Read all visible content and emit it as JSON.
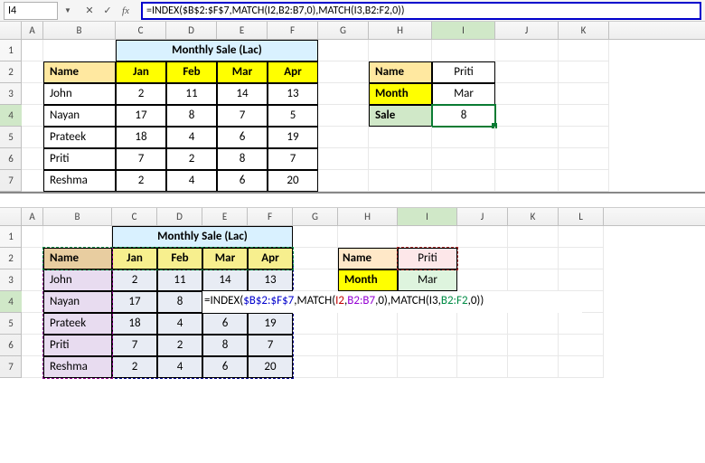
{
  "formula_bar": {
    "cell_ref": "I4",
    "fx_label": "fx",
    "formula": "=INDEX($B$2:$F$7,MATCH(I2,B2:B7,0),MATCH(I3,B2:F2,0))"
  },
  "columns": [
    "A",
    "B",
    "C",
    "D",
    "E",
    "F",
    "G",
    "H",
    "I",
    "J",
    "K",
    "L"
  ],
  "rows": [
    "1",
    "2",
    "3",
    "4",
    "5",
    "6",
    "7"
  ],
  "title": "Monthly Sale (Lac)",
  "headers": {
    "name": "Name",
    "months": [
      "Jan",
      "Feb",
      "Mar",
      "Apr"
    ]
  },
  "data": [
    {
      "name": "John",
      "vals": [
        "2",
        "11",
        "14",
        "13"
      ]
    },
    {
      "name": "Nayan",
      "vals": [
        "17",
        "8",
        "7",
        "5"
      ]
    },
    {
      "name": "Prateek",
      "vals": [
        "18",
        "4",
        "6",
        "19"
      ]
    },
    {
      "name": "Priti",
      "vals": [
        "7",
        "2",
        "8",
        "7"
      ]
    },
    {
      "name": "Reshma",
      "vals": [
        "2",
        "4",
        "6",
        "20"
      ]
    }
  ],
  "lookup_top": {
    "name_label": "Name",
    "name_value": "Priti",
    "month_label": "Month",
    "month_value": "Mar",
    "sale_label": "Sale",
    "sale_value": "8"
  },
  "lookup_bot": {
    "name_label": "Name",
    "name_value": "Priti",
    "month_label": "Month",
    "month_value": "Mar"
  },
  "edit_formula_tokens": [
    {
      "t": "=INDEX(",
      "c": "dark"
    },
    {
      "t": "$B$2:$F$7",
      "c": "blue"
    },
    {
      "t": ",MATCH(",
      "c": "dark"
    },
    {
      "t": "I2",
      "c": "red"
    },
    {
      "t": ",",
      "c": "dark"
    },
    {
      "t": "B2:B7",
      "c": "purple"
    },
    {
      "t": ",0),MATCH(I3,",
      "c": "dark"
    },
    {
      "t": "B2:F2",
      "c": "green"
    },
    {
      "t": ",0))",
      "c": "dark"
    }
  ]
}
